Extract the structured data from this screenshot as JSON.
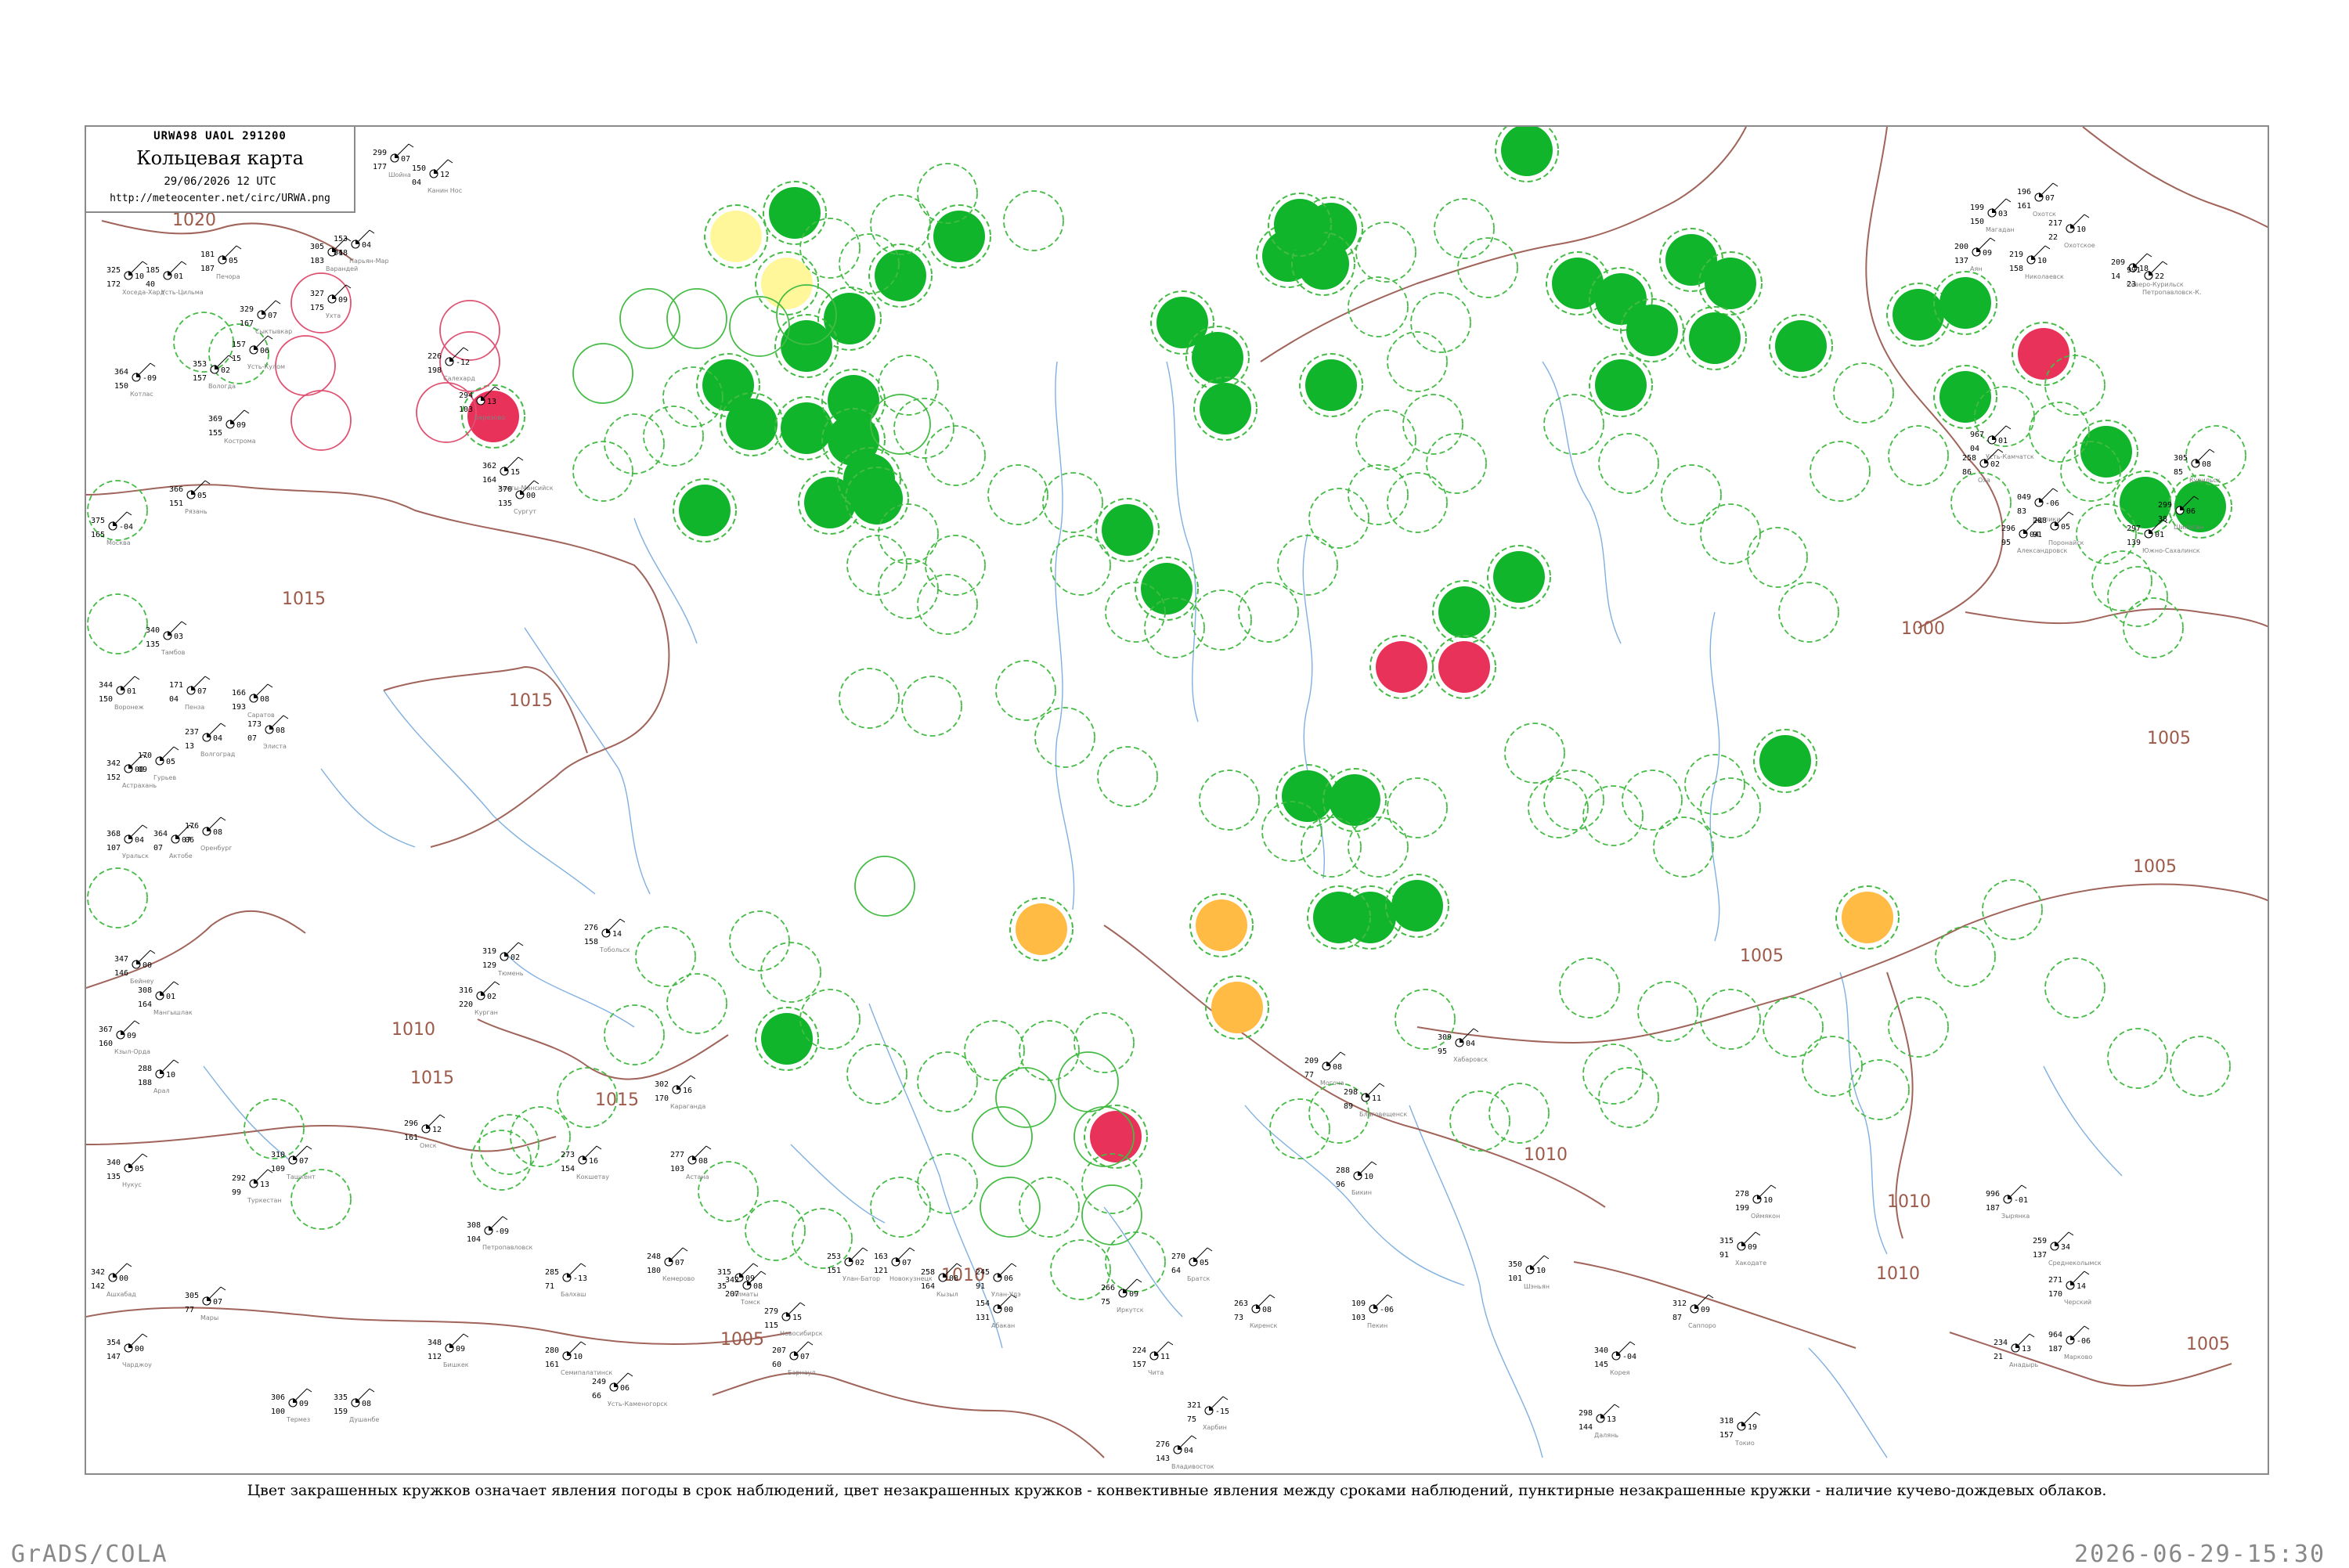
{
  "title_box": {
    "code": "URWA98  UAOL  291200",
    "title": "Кольцевая карта",
    "date": "29/06/2026 12 UTC",
    "url": "http://meteocenter.net/circ/URWA.png"
  },
  "caption": "Цвет закрашенных кружков означает явления погоды в срок наблюдений, цвет незакрашенных кружков - конвективные явления между сроками наблюдений, пунктирные незакрашенные кружки - наличие кучево-дождевых облаков.",
  "footer": {
    "left": "GrADS/COLA",
    "right": "2026-06-29-15:30"
  },
  "colors": {
    "isobar": "#a0645a",
    "river": "#7fb0e0",
    "green_fill": "#11b52c",
    "red_fill": "#e8325a",
    "yellow_fill": "#fff79a",
    "orange_fill": "#ffbb44",
    "dashed_ring": "#44bb44",
    "thunder_ring": "#e05070"
  },
  "isobar_labels": [
    {
      "text": "1020"
    },
    {
      "text": "1015"
    },
    {
      "text": "1015"
    },
    {
      "text": "1015"
    },
    {
      "text": "1015"
    },
    {
      "text": "1010"
    },
    {
      "text": "1010"
    },
    {
      "text": "1005"
    },
    {
      "text": "1010"
    },
    {
      "text": "1010"
    },
    {
      "text": "1005"
    },
    {
      "text": "1005"
    },
    {
      "text": "1000"
    },
    {
      "text": "1005"
    },
    {
      "text": "1010"
    },
    {
      "text": "1005"
    }
  ],
  "stations": [
    {
      "t": "299",
      "p": "07",
      "td": "177",
      "name": "Шойна"
    },
    {
      "t": "150",
      "p": "12",
      "td": "04",
      "name": "Канин Нос"
    },
    {
      "t": "305",
      "p": "18",
      "td": "183",
      "name": "Варандей"
    },
    {
      "t": "153",
      "p": "04",
      "td": "04",
      "name": "Нарьян-Мар"
    },
    {
      "t": "325",
      "p": "10",
      "td": "172",
      "name": "Хоседа-Хард"
    },
    {
      "t": "185",
      "p": "01",
      "td": "40",
      "name": "Усть-Цильма"
    },
    {
      "t": "181",
      "p": "05",
      "td": "187",
      "name": "Печора"
    },
    {
      "t": "327",
      "p": "09",
      "td": "175",
      "name": "Ухта"
    },
    {
      "t": "329",
      "p": "07",
      "td": "167",
      "name": "Сыктывкар"
    },
    {
      "t": "157",
      "p": "06",
      "td": "15",
      "name": "Усть-Кулом"
    },
    {
      "t": "364",
      "p": "-09",
      "td": "150",
      "name": "Котлас"
    },
    {
      "t": "353",
      "p": "02",
      "td": "157",
      "name": "Вологда"
    },
    {
      "t": "369",
      "p": "09",
      "td": "155",
      "name": "Кострома"
    },
    {
      "t": "375",
      "p": "-04",
      "td": "165",
      "name": "Москва"
    },
    {
      "t": "366",
      "p": "05",
      "td": "151",
      "name": "Рязань"
    },
    {
      "t": "340",
      "p": "03",
      "td": "135",
      "name": "Тамбов"
    },
    {
      "t": "344",
      "p": "01",
      "td": "150",
      "name": "Воронеж"
    },
    {
      "t": "171",
      "p": "07",
      "td": "04",
      "name": "Пенза"
    },
    {
      "t": "166",
      "p": "08",
      "td": "193",
      "name": "Саратов"
    },
    {
      "t": "237",
      "p": "04",
      "td": "13",
      "name": "Волгоград"
    },
    {
      "t": "173",
      "p": "08",
      "td": "07",
      "name": "Элиста"
    },
    {
      "t": "342",
      "p": "00",
      "td": "152",
      "name": "Астрахань"
    },
    {
      "t": "170",
      "p": "05",
      "td": "09",
      "name": "Гурьев"
    },
    {
      "t": "368",
      "p": "04",
      "td": "107",
      "name": "Уральск"
    },
    {
      "t": "364",
      "p": "07",
      "td": "07",
      "name": "Актобе"
    },
    {
      "t": "176",
      "p": "08",
      "td": "06",
      "name": "Оренбург"
    },
    {
      "t": "347",
      "p": "00",
      "td": "146",
      "name": "Бейнеу"
    },
    {
      "t": "308",
      "p": "01",
      "td": "164",
      "name": "Мангышлак"
    },
    {
      "t": "367",
      "p": "09",
      "td": "160",
      "name": "Кзыл-Орда"
    },
    {
      "t": "288",
      "p": "10",
      "td": "188",
      "name": "Арал"
    },
    {
      "t": "340",
      "p": "05",
      "td": "135",
      "name": "Нукус"
    },
    {
      "t": "292",
      "p": "13",
      "td": "99",
      "name": "Туркестан"
    },
    {
      "t": "310",
      "p": "07",
      "td": "109",
      "name": "Ташкент"
    },
    {
      "t": "342",
      "p": "00",
      "td": "142",
      "name": "Ашхабад"
    },
    {
      "t": "305",
      "p": "07",
      "td": "77",
      "name": "Мары"
    },
    {
      "t": "354",
      "p": "00",
      "td": "147",
      "name": "Чарджоу"
    },
    {
      "t": "306",
      "p": "09",
      "td": "100",
      "name": "Термез"
    },
    {
      "t": "335",
      "p": "08",
      "td": "159",
      "name": "Душанбе"
    },
    {
      "t": "226",
      "p": "-12",
      "td": "198",
      "name": "Салехард"
    },
    {
      "t": "294",
      "p": "13",
      "td": "103",
      "name": "Березово"
    },
    {
      "t": "362",
      "p": "15",
      "td": "164",
      "name": "Ханты-Мансийск"
    },
    {
      "t": "370",
      "p": "00",
      "td": "135",
      "name": "Сургут"
    },
    {
      "t": "276",
      "p": "14",
      "td": "158",
      "name": "Тобольск"
    },
    {
      "t": "319",
      "p": "02",
      "td": "129",
      "name": "Тюмень"
    },
    {
      "t": "316",
      "p": "02",
      "td": "220",
      "name": "Курган"
    },
    {
      "t": "296",
      "p": "12",
      "td": "161",
      "name": "Омск"
    },
    {
      "t": "308",
      "p": "-09",
      "td": "104",
      "name": "Петропавловск"
    },
    {
      "t": "273",
      "p": "16",
      "td": "154",
      "name": "Кокшетау"
    },
    {
      "t": "277",
      "p": "08",
      "td": "103",
      "name": "Астана"
    },
    {
      "t": "302",
      "p": "16",
      "td": "170",
      "name": "Караганда"
    },
    {
      "t": "285",
      "p": "-13",
      "td": "71",
      "name": "Балхаш"
    },
    {
      "t": "315",
      "p": "09",
      "td": "35",
      "name": "Алматы"
    },
    {
      "t": "348",
      "p": "09",
      "td": "112",
      "name": "Бишкек"
    },
    {
      "t": "280",
      "p": "10",
      "td": "161",
      "name": "Семипалатинск"
    },
    {
      "t": "249",
      "p": "06",
      "td": "66",
      "name": "Усть-Каменогорск"
    },
    {
      "t": "207",
      "p": "07",
      "td": "60",
      "name": "Барнаул"
    },
    {
      "t": "279",
      "p": "15",
      "td": "115",
      "name": "Новосибирск"
    },
    {
      "t": "342",
      "p": "08",
      "td": "207",
      "name": "Томск"
    },
    {
      "t": "248",
      "p": "07",
      "td": "180",
      "name": "Кемерово"
    },
    {
      "t": "163",
      "p": "07",
      "td": "121",
      "name": "Новокузнецк"
    },
    {
      "t": "154",
      "p": "00",
      "td": "131",
      "name": "Абакан"
    },
    {
      "t": "258",
      "p": "08",
      "td": "164",
      "name": "Кызыл"
    },
    {
      "t": "253",
      "p": "02",
      "td": "151",
      "name": "Улан-Батор"
    },
    {
      "t": "245",
      "p": "06",
      "td": "91",
      "name": "Улан-Удэ"
    },
    {
      "t": "266",
      "p": "09",
      "td": "75",
      "name": "Иркутск"
    },
    {
      "t": "270",
      "p": "05",
      "td": "64",
      "name": "Братск"
    },
    {
      "t": "263",
      "p": "08",
      "td": "73",
      "name": "Киренск"
    },
    {
      "t": "224",
      "p": "11",
      "td": "157",
      "name": "Чита"
    },
    {
      "t": "209",
      "p": "08",
      "td": "77",
      "name": "Могоча"
    },
    {
      "t": "298",
      "p": "11",
      "td": "89",
      "name": "Благовещенск"
    },
    {
      "t": "309",
      "p": "04",
      "td": "95",
      "name": "Хабаровск"
    },
    {
      "t": "288",
      "p": "10",
      "td": "96",
      "name": "Бикин"
    },
    {
      "t": "276",
      "p": "04",
      "td": "143",
      "name": "Владивосток"
    },
    {
      "t": "321",
      "p": "-15",
      "td": "75",
      "name": "Харбин"
    },
    {
      "t": "109",
      "p": "-06",
      "td": "103",
      "name": "Пекин"
    },
    {
      "t": "350",
      "p": "10",
      "td": "101",
      "name": "Шэньян"
    },
    {
      "t": "298",
      "p": "13",
      "td": "144",
      "name": "Далянь"
    },
    {
      "t": "340",
      "p": "-04",
      "td": "145",
      "name": "Корея"
    },
    {
      "t": "318",
      "p": "19",
      "td": "157",
      "name": "Токио"
    },
    {
      "t": "312",
      "p": "09",
      "td": "87",
      "name": "Саппоро"
    },
    {
      "t": "315",
      "p": "09",
      "td": "91",
      "name": "Хакодате"
    },
    {
      "t": "278",
      "p": "10",
      "td": "199",
      "name": "Оймякон"
    },
    {
      "t": "996",
      "p": "-01",
      "td": "187",
      "name": "Зырянка"
    },
    {
      "t": "259",
      "p": "34",
      "td": "137",
      "name": "Среднеколымск"
    },
    {
      "t": "271",
      "p": "14",
      "td": "170",
      "name": "Черский"
    },
    {
      "t": "234",
      "p": "13",
      "td": "21",
      "name": "Анадырь"
    },
    {
      "t": "964",
      "p": "-06",
      "td": "187",
      "name": "Марково"
    },
    {
      "t": "199",
      "p": "03",
      "td": "150",
      "name": "Магадан"
    },
    {
      "t": "196",
      "p": "07",
      "td": "161",
      "name": "Охотск"
    },
    {
      "t": "200",
      "p": "09",
      "td": "137",
      "name": "Аян"
    },
    {
      "t": "219",
      "p": "10",
      "td": "158",
      "name": "Николаевск"
    },
    {
      "t": "217",
      "p": "10",
      "td": "22",
      "name": "Охотское"
    },
    {
      "t": "209",
      "p": "18",
      "td": "14",
      "name": "Северо-Курильск"
    },
    {
      "t": "991",
      "p": "22",
      "td": "23",
      "name": "Петропавловск-К."
    },
    {
      "t": "967",
      "p": "01",
      "td": "04",
      "name": "Усть-Камчатск"
    },
    {
      "t": "258",
      "p": "02",
      "td": "86",
      "name": "Оха"
    },
    {
      "t": "049",
      "p": "-06",
      "td": "83",
      "name": "Ноглики"
    },
    {
      "t": "296",
      "p": "04",
      "td": "95",
      "name": "Александровск"
    },
    {
      "t": "288",
      "p": "05",
      "td": "91",
      "name": "Поронайск"
    },
    {
      "t": "297",
      "p": "01",
      "td": "139",
      "name": "Южно-Сахалинск"
    },
    {
      "t": "305",
      "p": "08",
      "td": "85",
      "name": "Курильск"
    },
    {
      "t": "299",
      "p": "06",
      "td": "38",
      "name": "Шикотан"
    }
  ]
}
